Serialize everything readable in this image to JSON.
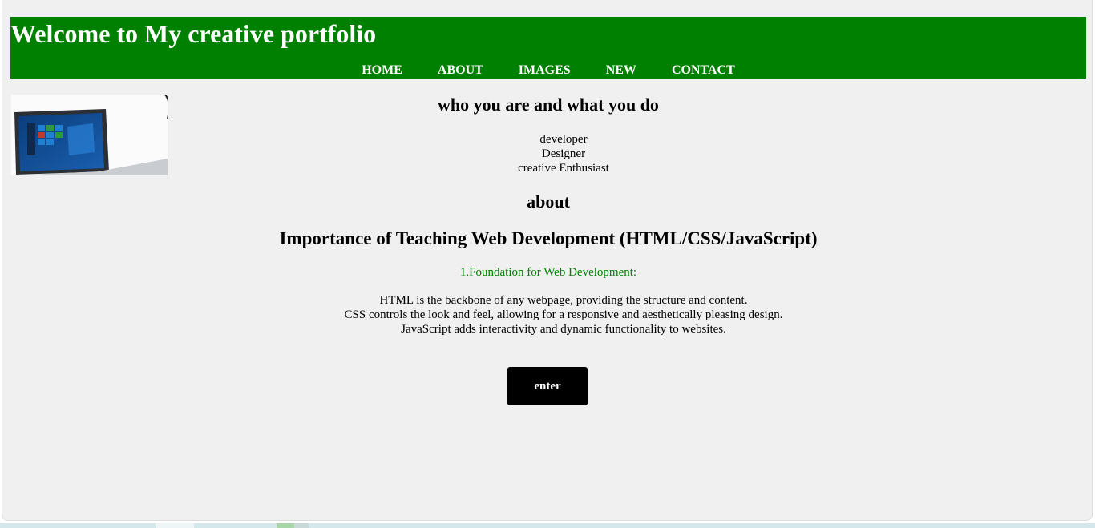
{
  "header": {
    "title": "Welcome to My creative portfolio",
    "nav": [
      "HOME",
      "ABOUT",
      "IMAGES",
      "NEW",
      "CONTACT"
    ]
  },
  "hero": {
    "tagline": "who you are and what you do",
    "roles": [
      "developer",
      "Designer",
      "creative Enthusiast"
    ]
  },
  "about": {
    "heading": "about",
    "subheading": "Importance of Teaching Web Development (HTML/CSS/JavaScript)",
    "point_title": "1.Foundation for Web Development:",
    "point_lines": [
      "HTML is the backbone of any webpage, providing the structure and content.",
      "CSS controls the look and feel, allowing for a responsive and aesthetically pleasing design.",
      "JavaScript adds interactivity and dynamic functionality to websites."
    ]
  },
  "actions": {
    "enter_label": "enter"
  },
  "colors": {
    "header_bg": "#008000",
    "point_title": "#008000",
    "button_bg": "#000000"
  }
}
